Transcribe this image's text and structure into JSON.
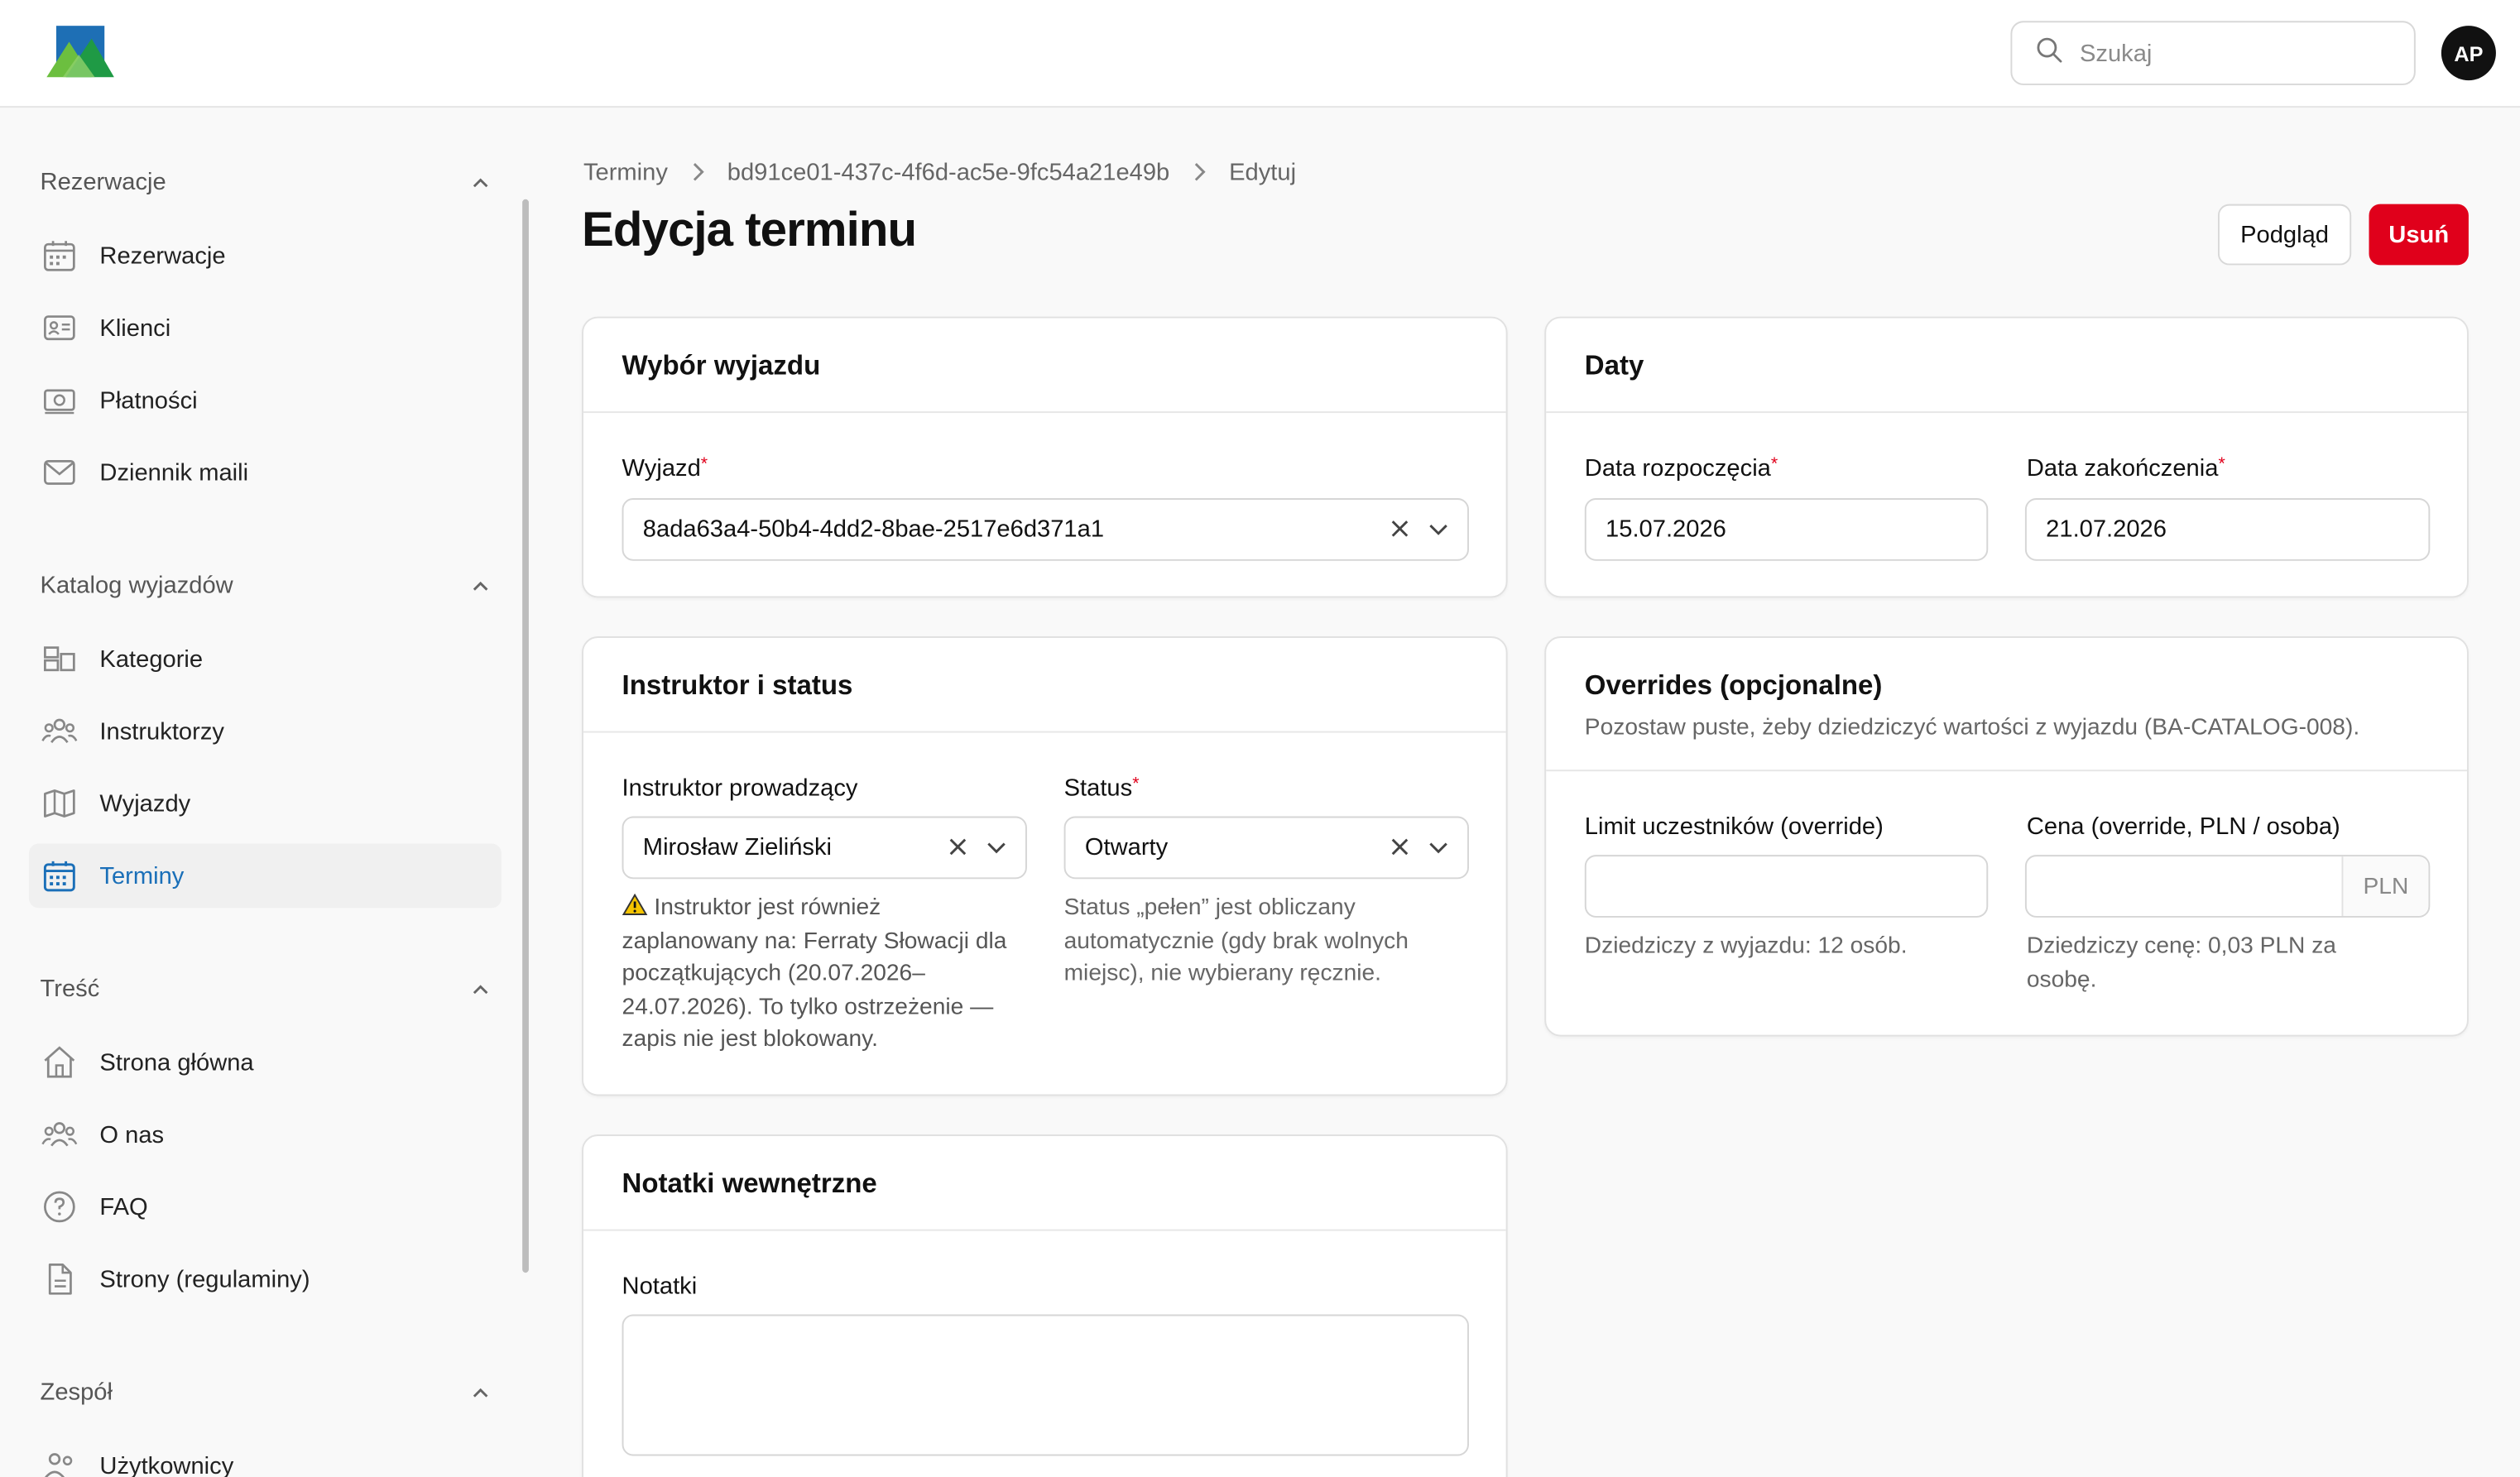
{
  "header": {
    "search_placeholder": "Szukaj",
    "avatar_initials": "AP"
  },
  "sidebar": {
    "groups": [
      {
        "title": "Rezerwacje",
        "items": [
          {
            "label": "Rezerwacje",
            "icon": "calendar-icon"
          },
          {
            "label": "Klienci",
            "icon": "id-card-icon"
          },
          {
            "label": "Płatności",
            "icon": "money-icon"
          },
          {
            "label": "Dziennik maili",
            "icon": "mail-icon"
          }
        ]
      },
      {
        "title": "Katalog wyjazdów",
        "items": [
          {
            "label": "Kategorie",
            "icon": "categories-icon"
          },
          {
            "label": "Instruktorzy",
            "icon": "users-icon"
          },
          {
            "label": "Wyjazdy",
            "icon": "map-icon"
          },
          {
            "label": "Terminy",
            "icon": "calendar-grid-icon",
            "active": true
          }
        ]
      },
      {
        "title": "Treść",
        "items": [
          {
            "label": "Strona główna",
            "icon": "home-icon"
          },
          {
            "label": "O nas",
            "icon": "users-icon"
          },
          {
            "label": "FAQ",
            "icon": "question-icon"
          },
          {
            "label": "Strony (regulaminy)",
            "icon": "document-icon"
          }
        ]
      },
      {
        "title": "Zespół",
        "items": [
          {
            "label": "Użytkownicy",
            "icon": "users-icon"
          }
        ]
      }
    ]
  },
  "breadcrumb": [
    "Terminy",
    "bd91ce01-437c-4f6d-ac5e-9fc54a21e49b",
    "Edytuj"
  ],
  "page": {
    "title": "Edycja terminu",
    "preview_label": "Podgląd",
    "delete_label": "Usuń"
  },
  "trip_card": {
    "title": "Wybór wyjazdu",
    "trip_label": "Wyjazd",
    "trip_value": "8ada63a4-50b4-4dd2-8bae-2517e6d371a1"
  },
  "dates_card": {
    "title": "Daty",
    "start_label": "Data rozpoczęcia",
    "start_value": "15.07.2026",
    "end_label": "Data zakończenia",
    "end_value": "21.07.2026"
  },
  "instructor_card": {
    "title": "Instruktor i status",
    "instructor_label": "Instruktor prowadzący",
    "instructor_value": "Mirosław Zieliński",
    "instructor_warning": "Instruktor jest również zaplanowany na: Ferraty Słowacji dla początkujących (20.07.2026–24.07.2026). To tylko ostrzeżenie — zapis nie jest blokowany.",
    "status_label": "Status",
    "status_value": "Otwarty",
    "status_help": "Status „pełen” jest obliczany automatycznie (gdy brak wolnych miejsc), nie wybierany ręcznie."
  },
  "overrides_card": {
    "title": "Overrides (opcjonalne)",
    "subtitle": "Pozostaw puste, żeby dziedziczyć wartości z wyjazdu (BA-CATALOG-008).",
    "limit_label": "Limit uczestników (override)",
    "limit_value": "",
    "limit_help": "Dziedziczy z wyjazdu: 12 osób.",
    "price_label": "Cena (override, PLN / osoba)",
    "price_value": "",
    "price_suffix": "PLN",
    "price_help": "Dziedziczy cenę: 0,03 PLN za osobę."
  },
  "notes_card": {
    "title": "Notatki wewnętrzne",
    "notes_label": "Notatki",
    "notes_value": ""
  },
  "colors": {
    "accent_danger": "#e0001b",
    "active_nav": "#1a6fb8",
    "warning": "#f5c400"
  }
}
